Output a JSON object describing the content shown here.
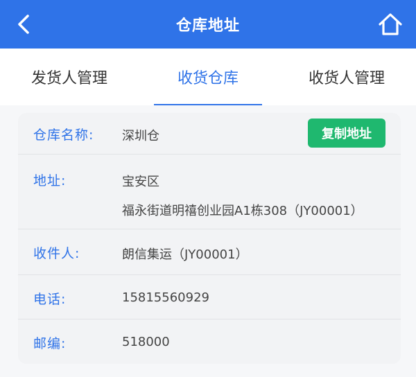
{
  "header": {
    "title": "仓库地址",
    "back_icon": "chevron-left-icon",
    "home_icon": "home-icon",
    "bg_color": "#2f73e8"
  },
  "tabs": [
    {
      "label": "发货人管理",
      "active": false
    },
    {
      "label": "收货仓库",
      "active": true
    },
    {
      "label": "收货人管理",
      "active": false
    }
  ],
  "warehouse": {
    "name_label": "仓库名称:",
    "name_value": "深圳仓",
    "copy_label": "复制地址",
    "address_label": "地址:",
    "address_line1": "宝安区",
    "address_line2": "福永街道明禧创业园A1栋308（JY00001）",
    "receiver_label": "收件人:",
    "receiver_value": "朗信集运（JY00001）",
    "phone_label": "电话:",
    "phone_value": "15815560929",
    "zip_label": "邮编:",
    "zip_value": "518000"
  },
  "colors": {
    "accent": "#2f73e8",
    "copy_button": "#1fb86f"
  }
}
